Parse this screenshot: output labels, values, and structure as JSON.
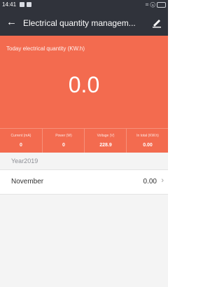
{
  "status": {
    "time": "14:41",
    "right_icons": "⌗ ⓧ"
  },
  "topbar": {
    "title": "Electrical quantity managem...",
    "back_icon": "arrow-left-icon",
    "edit_icon": "pencil-icon"
  },
  "hero": {
    "label": "Today electrical quantity (KW.h)",
    "value": "0.0"
  },
  "stats": [
    {
      "label": "Current (mA)",
      "value": "0"
    },
    {
      "label": "Power (W)",
      "value": "0"
    },
    {
      "label": "Voltage (V)",
      "value": "228.9"
    },
    {
      "label": "In total (KW.h)",
      "value": "0.00"
    }
  ],
  "history": {
    "year_label": "Year2019",
    "months": [
      {
        "name": "November",
        "value": "0.00"
      }
    ]
  },
  "colors": {
    "accent": "#f36b4f",
    "toolbar": "#30333b",
    "background": "#f4f4f4"
  }
}
